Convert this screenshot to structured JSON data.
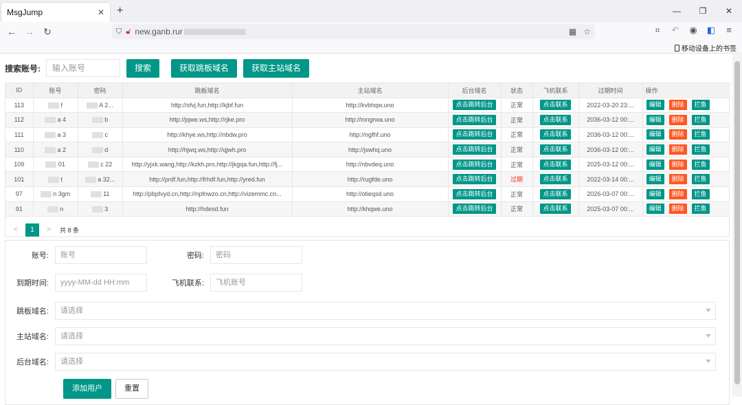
{
  "browser": {
    "tab_title": "MsgJump",
    "tab_close": "✕",
    "new_tab": "+",
    "url": "new.ganb.rur",
    "bookmarks_label": "移动设备上的书签"
  },
  "search": {
    "label": "搜索账号:",
    "placeholder": "输入账号",
    "search_button": "搜索",
    "get_jump_button": "获取跳板域名",
    "get_main_button": "获取主站域名"
  },
  "table": {
    "columns": [
      "ID",
      "账号",
      "密码",
      "跳板域名",
      "主站域名",
      "后台域名",
      "状态",
      "飞机联系",
      "过期时间",
      "操作"
    ],
    "backend_button": "点击跳转后台",
    "contact_button": "点击联系",
    "edit_button": "编辑",
    "delete_button": "删除",
    "block_button": "拦鱼",
    "rows": [
      {
        "id": "113",
        "account": "f",
        "password": "A 2...",
        "jump": "http://sfvj.fun,http://kjbf.fun",
        "main": "http://kvbhqw.uno",
        "status": "正常",
        "expire": "2022-03-20 23:..."
      },
      {
        "id": "112",
        "account": "a 4",
        "password": "b",
        "jump": "http://jqwe.ws,http://rjke.pro",
        "main": "http://mngrwa.uno",
        "status": "正常",
        "expire": "2036-03-12 00:..."
      },
      {
        "id": "111",
        "account": "a 3",
        "password": "c",
        "jump": "http://khye.ws,http://nbdw.pro",
        "main": "http://ngfhf.uno",
        "status": "正常",
        "expire": "2036-03-12 00:..."
      },
      {
        "id": "110",
        "account": "a 2",
        "password": "d",
        "jump": "http://hjwq.ws,http://qjwh.pro",
        "main": "http://jswhq.uno",
        "status": "正常",
        "expire": "2036-03-12 00:..."
      },
      {
        "id": "109",
        "account": "01",
        "password": "c 22",
        "jump": "http://yjxk.wang,http://kzkh.pro,http://jkgqa.fun,http://fj...",
        "main": "http://nbvdeq.uno",
        "status": "正常",
        "expire": "2025-03-12 00:..."
      },
      {
        "id": "101",
        "account": "t",
        "password": "a 32...",
        "jump": "http://prdf.fun,http://frhdf.fun,http://yred.fun",
        "main": "http://rugfde.uno",
        "status": "过期",
        "expire": "2022-03-14 00:..."
      },
      {
        "id": "97",
        "account": "n 3gm",
        "password": "11",
        "jump": "http://pbpfvyd.cn,http://npfnwzo.cn,http://vizemmc.cn...",
        "main": "http://otieqsd.uno",
        "status": "正常",
        "expire": "2026-03-07 00:..."
      },
      {
        "id": "91",
        "account": "n",
        "password": "3",
        "jump": "http://hdesd.fun",
        "main": "http://khqwe.uno",
        "status": "正常",
        "expire": "2025-03-07 00:..."
      }
    ]
  },
  "pagination": {
    "prev": "<",
    "current": "1",
    "next": ">",
    "total": "共 8 条"
  },
  "form": {
    "account_label": "账号:",
    "account_placeholder": "账号",
    "password_label": "密码:",
    "password_placeholder": "密码",
    "expire_label": "到期时间:",
    "expire_placeholder": "yyyy-MM-dd HH:mm",
    "contact_label": "飞机联系:",
    "contact_placeholder": "飞机账号",
    "jump_label": "跳板域名:",
    "main_label": "主站域名:",
    "backend_label": "后台域名:",
    "select_placeholder": "请选择",
    "add_button": "添加用户",
    "reset_button": "重置"
  },
  "colors": {
    "primary": "#009688",
    "danger": "#ff5722",
    "expired_text": "#ff2222"
  }
}
